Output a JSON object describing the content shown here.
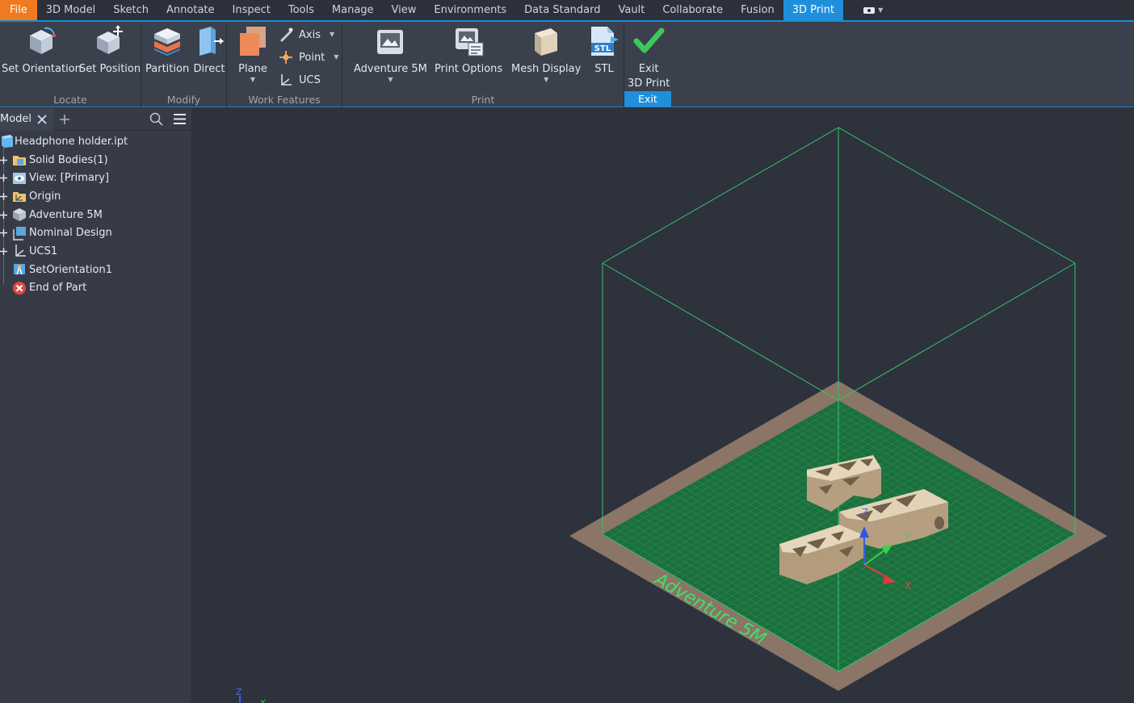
{
  "menu": {
    "items": [
      "File",
      "3D Model",
      "Sketch",
      "Annotate",
      "Inspect",
      "Tools",
      "Manage",
      "View",
      "Environments",
      "Data Standard",
      "Vault",
      "Collaborate",
      "Fusion",
      "3D Print"
    ],
    "active": "3D Print"
  },
  "ribbon": {
    "locate": {
      "label": "Locate",
      "set_orientation": "Set Orientation",
      "set_position": "Set Position"
    },
    "modify": {
      "label": "Modify",
      "partition": "Partition",
      "direct": "Direct"
    },
    "work_features": {
      "label": "Work Features",
      "plane": "Plane",
      "axis": "Axis",
      "point": "Point",
      "ucs": "UCS"
    },
    "print": {
      "label": "Print",
      "adventure": "Adventure 5M",
      "print_options": "Print Options",
      "mesh_display": "Mesh Display",
      "stl": "STL",
      "stl_icon_text": "STL"
    },
    "exit": {
      "label": "Exit",
      "exit_line1": "Exit",
      "exit_line2": "3D Print"
    }
  },
  "browser": {
    "tab": "Model",
    "root": "Headphone holder.ipt",
    "nodes": [
      "Solid Bodies(1)",
      "View: [Primary]",
      "Origin",
      "Adventure 5M",
      "Nominal Design",
      "UCS1",
      "SetOrientation1",
      "End of Part"
    ]
  },
  "viewport": {
    "bed_label": "Adventure 5M",
    "triad": {
      "z": "Z",
      "y": "Y",
      "x": "X"
    },
    "mini_triad": {
      "z": "Z",
      "x": "X"
    },
    "colors": {
      "bed": "#8a7566",
      "plate": "#1c6e3e",
      "grid": "#39b865",
      "envelope": "#37c46a",
      "part": "#d8c6a6"
    }
  }
}
